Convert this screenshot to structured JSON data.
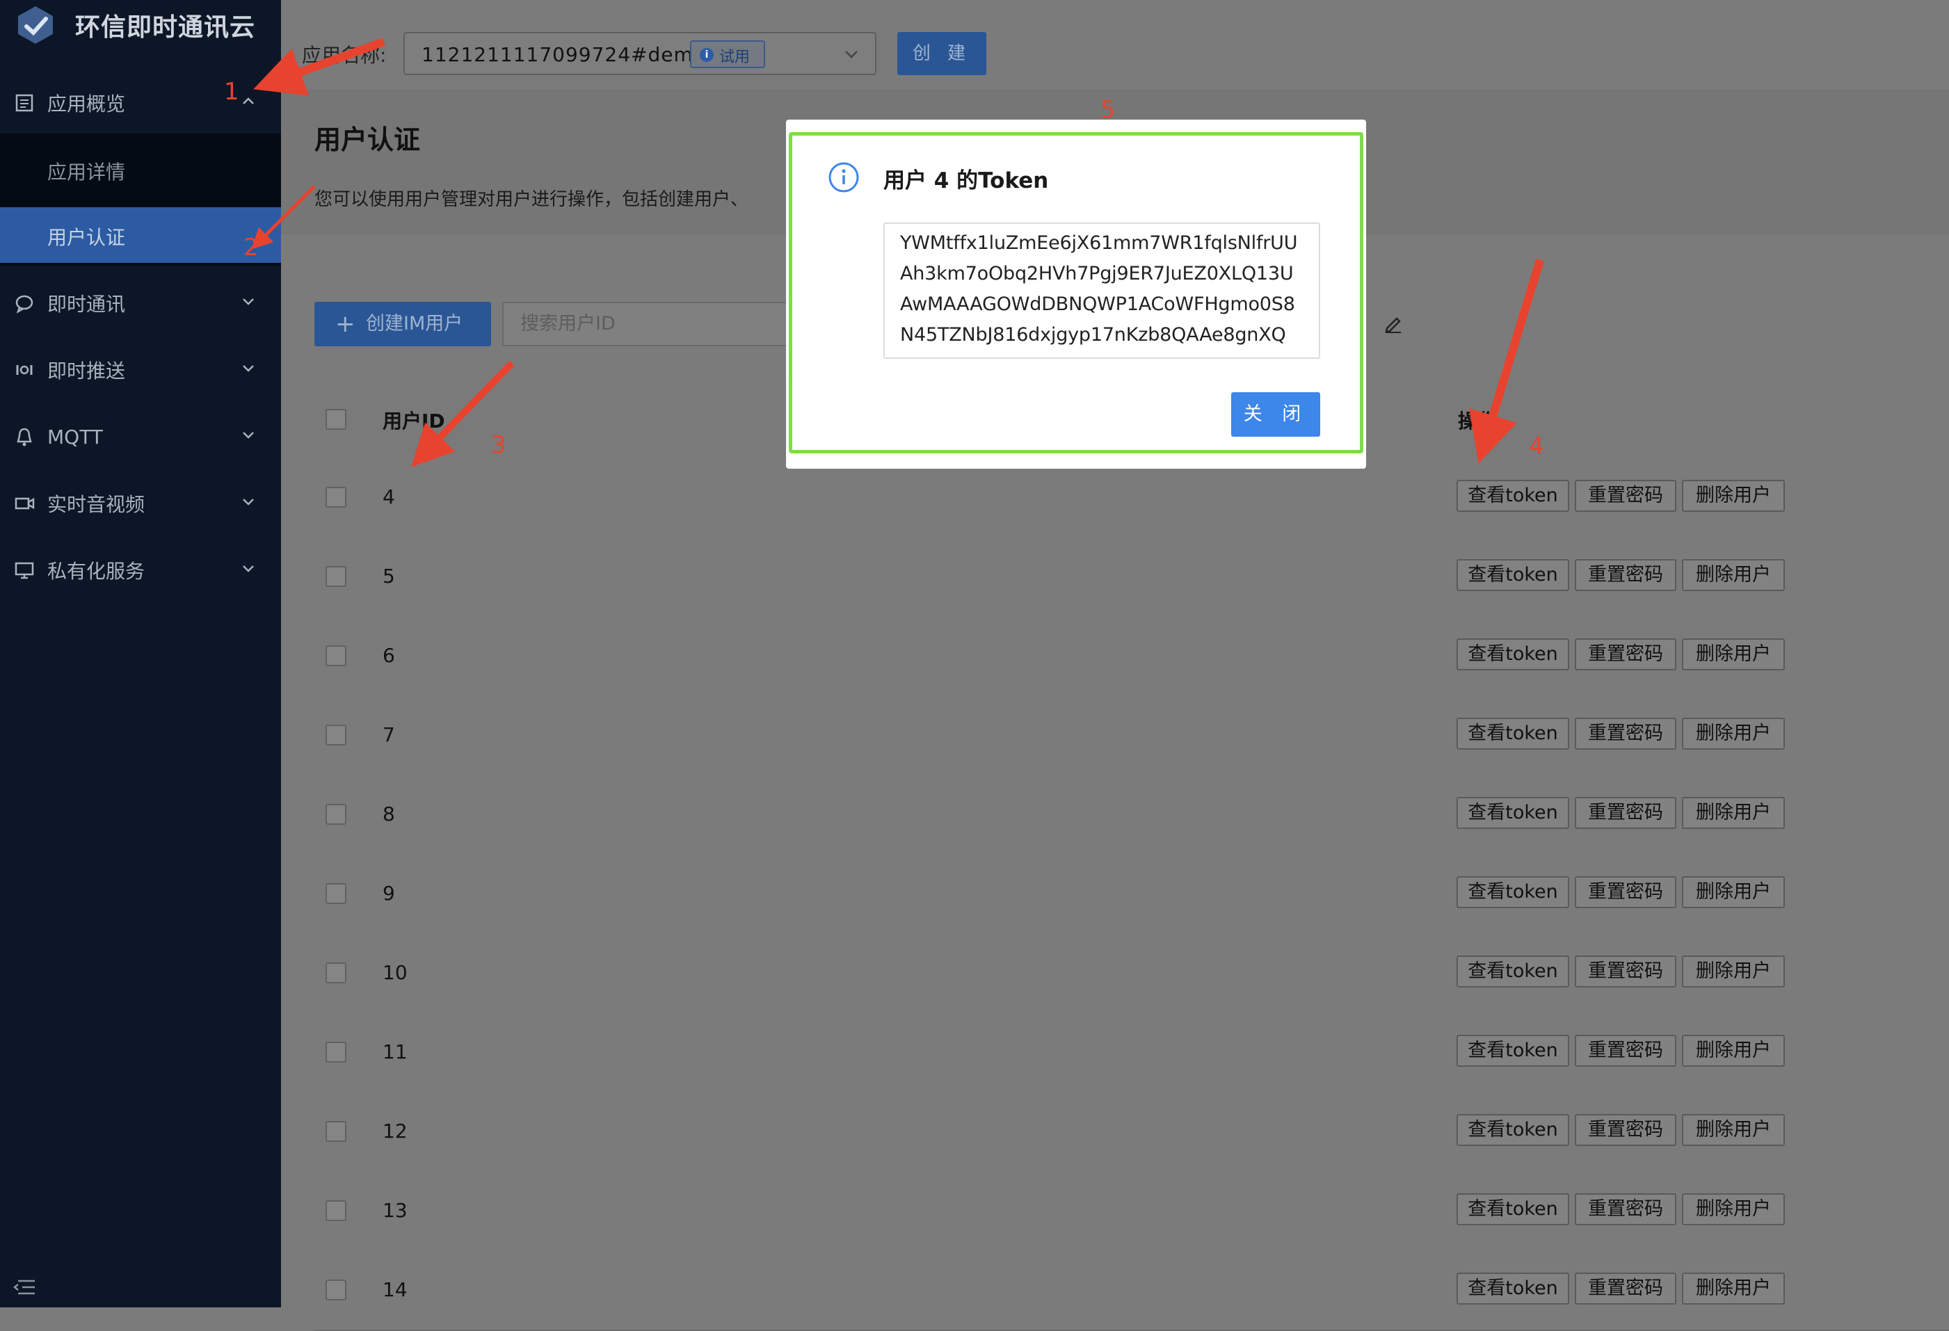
{
  "app": {
    "brand": "环信即时通讯云"
  },
  "sidebar": {
    "items": [
      {
        "label": "应用概览",
        "icon": "overview-icon"
      },
      {
        "label": "即时通讯",
        "icon": "chat-icon"
      },
      {
        "label": "即时推送",
        "icon": "push-icon"
      },
      {
        "label": "MQTT",
        "icon": "mqtt-icon"
      },
      {
        "label": "实时音视频",
        "icon": "video-icon"
      },
      {
        "label": "私有化服务",
        "icon": "server-icon"
      }
    ],
    "sub_items": [
      {
        "label": "应用详情"
      },
      {
        "label": "用户认证"
      }
    ],
    "active": "用户认证"
  },
  "topbar": {
    "app_label": "应用名称:",
    "app_name": "1121211117099724#demo",
    "trial_badge": "试用",
    "create_label": "创 建"
  },
  "page": {
    "title": "用户认证",
    "description": "您可以使用用户管理对用户进行操作，包括创建用户、"
  },
  "toolbar": {
    "create_im_user": "创建IM用户",
    "search_placeholder": "搜索用户ID"
  },
  "table": {
    "col_user_id": "用户ID",
    "col_actions": "操作",
    "rows": [
      {
        "id": "4"
      },
      {
        "id": "5"
      },
      {
        "id": "6"
      },
      {
        "id": "7"
      },
      {
        "id": "8"
      },
      {
        "id": "9"
      },
      {
        "id": "10"
      },
      {
        "id": "11"
      },
      {
        "id": "12"
      },
      {
        "id": "13"
      },
      {
        "id": "14"
      }
    ],
    "actions": {
      "view_token": "查看token",
      "reset_password": "重置密码",
      "delete_user": "删除用户"
    }
  },
  "modal": {
    "title": "用户 4 的Token",
    "token_lines": [
      "YWMtffx1luZmEe6jX61mm7WR1fqlsNlfrUU",
      "Ah3km7oObq2HVh7Pgj9ER7JuEZ0XLQ13U",
      "AwMAAAGOWdDBNQWP1ACoWFHgmo0S8",
      "N45TZNbJ816dxjgyp17nKzb8QAAe8gnXQ"
    ],
    "close_label": "关 闭"
  },
  "annotations": [
    "1",
    "2",
    "3",
    "4",
    "5"
  ],
  "colors": {
    "sidebar_bg": "#0c1626",
    "active_item": "#2c5ba3",
    "primary_button": "#3d86ea",
    "annotation_red": "#e8432e",
    "modal_highlight": "#7ddc4a"
  }
}
